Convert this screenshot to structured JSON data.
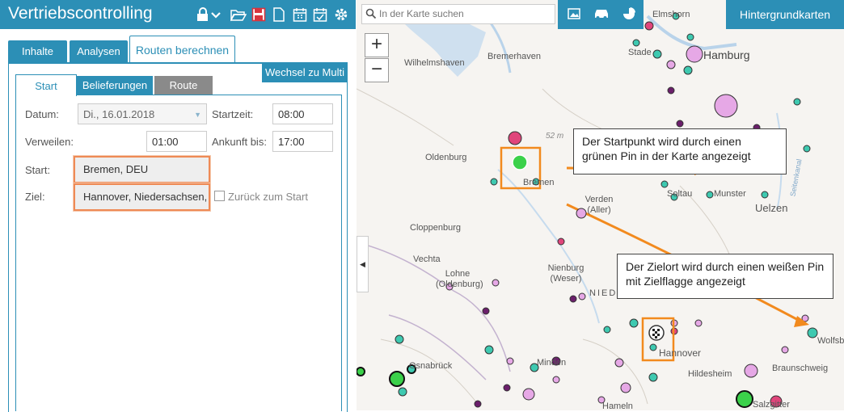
{
  "app": {
    "title": "Vertriebscontrolling",
    "icons": [
      "lock-icon",
      "chevron-down-icon",
      "folder-open-icon",
      "save-icon",
      "new-file-icon",
      "calendar-icon",
      "calendar-check-icon",
      "gear-icon"
    ]
  },
  "tabs": {
    "items": [
      "Inhalte",
      "Analysen",
      "Routen berechnen"
    ],
    "active": "Routen berechnen"
  },
  "wechsel_label": "Wechsel zu Multi",
  "subtabs": {
    "items": [
      "Start",
      "Belieferungen",
      "Route"
    ],
    "active": "Start"
  },
  "form": {
    "datum_label": "Datum:",
    "datum_value": "Di., 16.01.2018",
    "startzeit_label": "Startzeit:",
    "startzeit_value": "08:00",
    "verweilen_label": "Verweilen:",
    "verweilen_value": "01:00",
    "ankunft_label": "Ankunft bis:",
    "ankunft_value": "17:00",
    "start_label": "Start:",
    "start_value": "Bremen, DEU",
    "ziel_label": "Ziel:",
    "ziel_value": "Hannover, Niedersachsen,",
    "zurueck_label": "Zurück zum Start"
  },
  "map": {
    "search_placeholder": "In der Karte suchen",
    "hintergrund_label": "Hintergrundkarten",
    "zoom_in": "+",
    "zoom_out": "−",
    "collapse": "◀",
    "toolbar_icons": [
      "image-icon",
      "car-icon",
      "pie-chart-icon"
    ],
    "cities": [
      "Wilhelmshaven",
      "Bremerhaven",
      "Stade",
      "Hamburg",
      "Elmshorn",
      "Oldenburg",
      "Bremen",
      "Verden (Aller)",
      "Soltau",
      "Munster",
      "Uelzen",
      "Cloppenburg",
      "Vechta",
      "Lohne (Oldenburg)",
      "Nienburg (Weser)",
      "NIEDER",
      "Minden",
      "Hannover",
      "Osnabrück",
      "Hildesheim",
      "Braunschweig",
      "Wolfsb",
      "Salzgitter",
      "Hameln"
    ],
    "scale_text": "52 m",
    "river_label": "Seitenkanal",
    "colors": {
      "teal": "#3ec9b0",
      "pink": "#e6a8e6",
      "magenta": "#e0457b",
      "purple": "#6b1f6b",
      "green": "#3bd14a"
    }
  },
  "callouts": {
    "start": "Der Startpunkt wird durch einen grünen Pin in der Karte angezeigt",
    "ziel": "Der Zielort wird durch einen weißen Pin mit Zielflagge angezeigt"
  }
}
